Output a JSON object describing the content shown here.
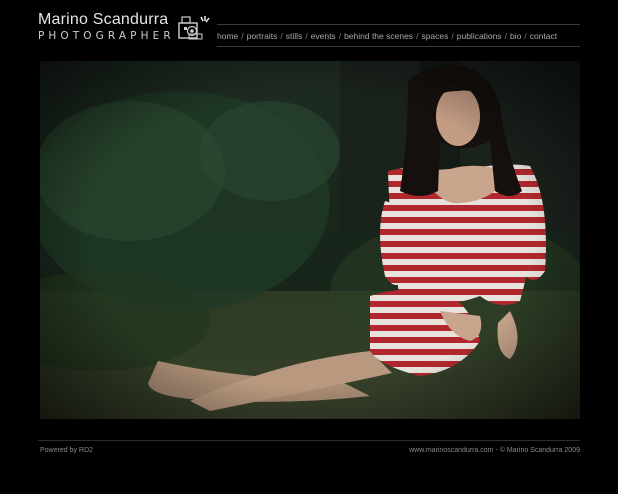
{
  "brand": {
    "name": "Marino Scandurra",
    "subtitle": "PHOTOGRAPHER"
  },
  "nav": {
    "items": [
      {
        "label": "home"
      },
      {
        "label": "portraits"
      },
      {
        "label": "stills"
      },
      {
        "label": "events"
      },
      {
        "label": "behind the scenes"
      },
      {
        "label": "spaces"
      },
      {
        "label": "publications"
      },
      {
        "label": "bio"
      },
      {
        "label": "contact"
      }
    ],
    "separator": "/"
  },
  "footer": {
    "powered_by": "Powered by RD2",
    "copyright": "www.marinoscandurra.com - © Marino Scandurra 2009"
  },
  "icons": {
    "logo": "camera-icon"
  },
  "colors": {
    "background": "#000000",
    "text": "#e6e6e6",
    "nav_text": "#a8a8a8",
    "dress_red": "#b0282e"
  }
}
